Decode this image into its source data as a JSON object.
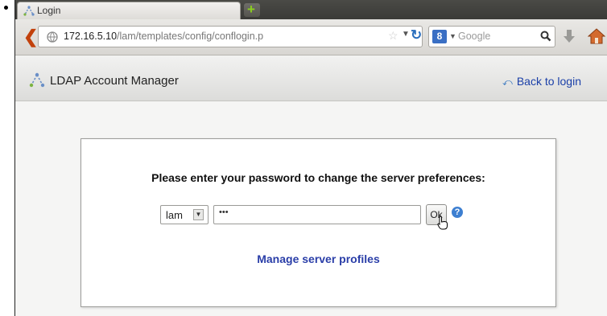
{
  "tab": {
    "title": "Login",
    "new_tab_symbol": "+"
  },
  "navbar": {
    "url_host": "172.16.5.10",
    "url_path": "/lam/templates/config/conflogin.p",
    "search_engine_letter": "8",
    "search_placeholder": "Google"
  },
  "header": {
    "app_title": "LDAP Account Manager",
    "back_link": "Back to login"
  },
  "login": {
    "prompt": "Please enter your password to change the server preferences:",
    "server_profile": "lam",
    "password_value": "•••",
    "ok_label": "Ok",
    "help_symbol": "?",
    "manage_link": "Manage server profiles"
  },
  "colors": {
    "link": "#1a3fa8",
    "help_icon": "#3d7fd1",
    "back_arrow": "#c2410c",
    "new_tab_plus": "#8bd01e"
  },
  "icons": {
    "tab": "lam-logo-icon",
    "back": "back-arrow-icon",
    "reload": "reload-icon",
    "download": "download-icon",
    "home": "home-icon",
    "cursor": "hand-cursor-icon"
  }
}
